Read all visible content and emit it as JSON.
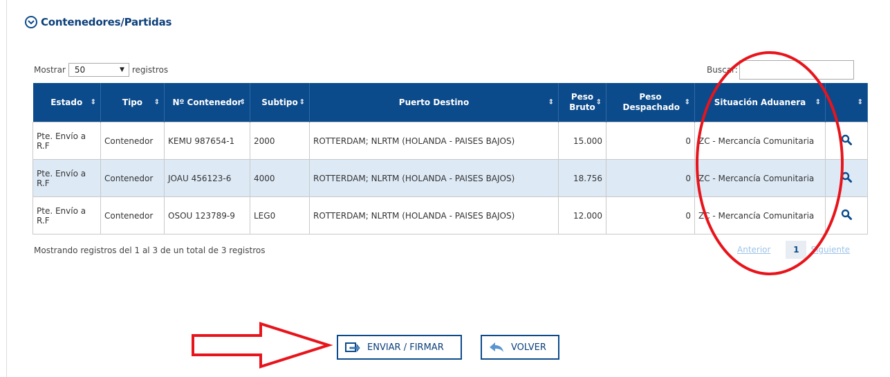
{
  "section": {
    "title": "Contenedores/Partidas",
    "toggle_icon": "chevron-circle-down-icon"
  },
  "controls": {
    "show_label": "Mostrar",
    "page_size": "50",
    "records_label": "registros",
    "search_label": "Buscar:",
    "search_value": ""
  },
  "table": {
    "headers": [
      "Estado",
      "Tipo",
      "Nº Contenedor",
      "Subtipo",
      "Puerto Destino",
      "Peso Bruto",
      "Peso Despachado",
      "Situación Aduanera",
      ""
    ],
    "rows": [
      {
        "estado": "Pte. Envío a R.F",
        "tipo": "Contenedor",
        "contenedor": "KEMU 987654-1",
        "subtipo": "2000",
        "puerto": "ROTTERDAM; NLRTM (HOLANDA - PAISES BAJOS)",
        "peso_bruto": "15.000",
        "peso_despachado": "0",
        "situacion": "ZC - Mercancía Comunitaria"
      },
      {
        "estado": "Pte. Envío a R.F",
        "tipo": "Contenedor",
        "contenedor": "JOAU 456123-6",
        "subtipo": "4000",
        "puerto": "ROTTERDAM; NLRTM (HOLANDA - PAISES BAJOS)",
        "peso_bruto": "18.756",
        "peso_despachado": "0",
        "situacion": "ZC - Mercancía Comunitaria"
      },
      {
        "estado": "Pte. Envío a R.F",
        "tipo": "Contenedor",
        "contenedor": "OSOU 123789-9",
        "subtipo": "LEG0",
        "puerto": "ROTTERDAM; NLRTM (HOLANDA - PAISES BAJOS)",
        "peso_bruto": "12.000",
        "peso_despachado": "0",
        "situacion": "ZC - Mercancía Comunitaria"
      }
    ]
  },
  "info": "Mostrando registros del 1 al 3 de un total de 3 registros",
  "pagination": {
    "previous": "Anterior",
    "current": "1",
    "next": "Siguiente"
  },
  "buttons": {
    "send": "ENVIAR / FIRMAR",
    "back": "VOLVER"
  },
  "colors": {
    "header": "#0b4a8b",
    "row_alt": "#dde9f5",
    "annotation": "#e8141b"
  }
}
